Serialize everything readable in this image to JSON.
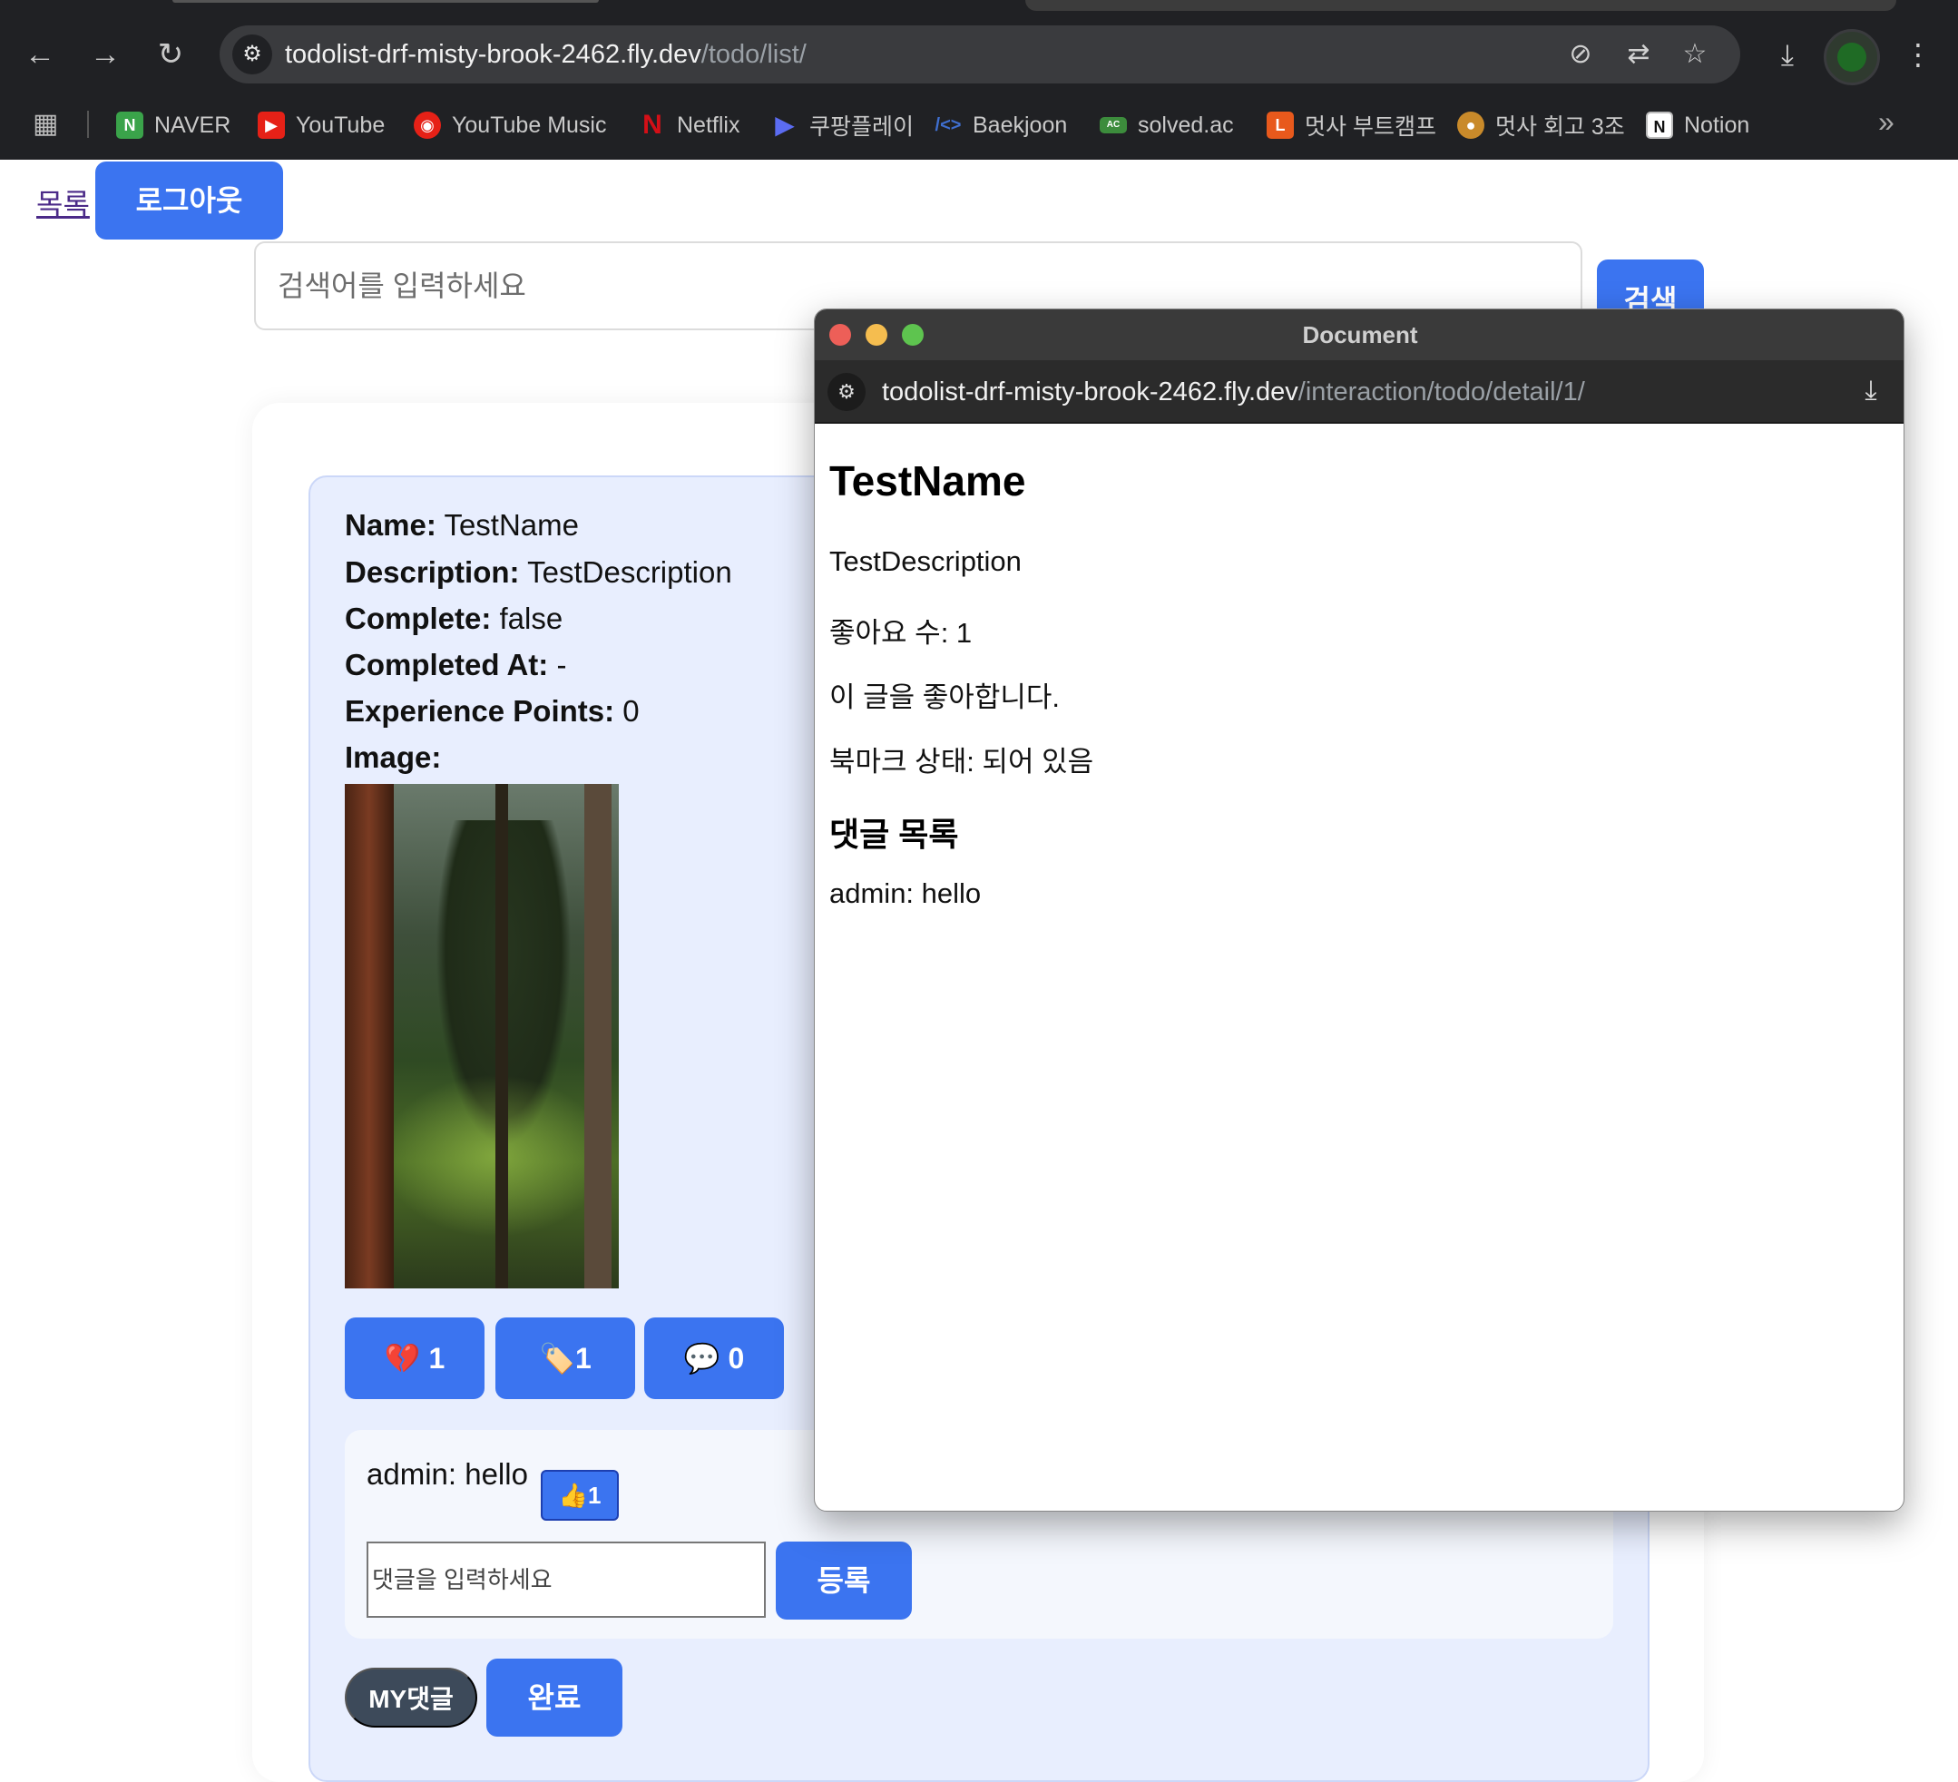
{
  "browser": {
    "url_host": "todolist-drf-misty-brook-2462.fly.dev",
    "url_path": "/todo/list/",
    "bookmarks": [
      {
        "label": "NAVER",
        "icon": "naver-icon",
        "color": "#3aa34a"
      },
      {
        "label": "YouTube",
        "icon": "youtube-icon",
        "color": "#e62117"
      },
      {
        "label": "YouTube Music",
        "icon": "youtube-music-icon",
        "color": "#e62117"
      },
      {
        "label": "Netflix",
        "icon": "netflix-icon",
        "color": "#d40f17"
      },
      {
        "label": "쿠팡플레이",
        "icon": "coupang-play-icon",
        "color": "#5b6cf2"
      },
      {
        "label": "Baekjoon",
        "icon": "baekjoon-icon",
        "color": "#3f6fd0"
      },
      {
        "label": "solved.ac",
        "icon": "solved-ac-icon",
        "color": "#3c8c3c"
      },
      {
        "label": "멋사 부트캠프",
        "icon": "likelion-bootcamp-icon",
        "color": "#e8591c"
      },
      {
        "label": "멋사 회고 3조",
        "icon": "likelion-retro-icon",
        "color": "#c98a2a"
      },
      {
        "label": "Notion",
        "icon": "notion-icon",
        "color": "#ffffff"
      }
    ]
  },
  "page": {
    "list_link": "목록",
    "logout_label": "로그아웃",
    "search_placeholder": "검색어를 입력하세요",
    "search_label": "검색",
    "todo": {
      "name_label": "Name:",
      "name_value": "TestName",
      "description_label": "Description:",
      "description_value": "TestDescription",
      "complete_label": "Complete:",
      "complete_value": "false",
      "completed_at_label": "Completed At:",
      "completed_at_value": "-",
      "xp_label": "Experience Points:",
      "xp_value": "0",
      "image_label": "Image:"
    },
    "actions": {
      "like_icon": "💔",
      "like_count": "1",
      "bookmark_icon": "🏷️",
      "bookmark_count": "1",
      "comment_icon": "💬",
      "comment_count": "0"
    },
    "comment": {
      "text": "admin: hello",
      "like_icon": "👍",
      "like_count": "1",
      "input_placeholder": "댓글을 입력하세요",
      "register_label": "등록"
    },
    "my_comments_label": "MY댓글",
    "complete_label": "완료",
    "accent_color": "#3b74f0"
  },
  "popup": {
    "window_title": "Document",
    "url_host": "todolist-drf-misty-brook-2462.fly.dev",
    "url_path": "/interaction/todo/detail/1/",
    "heading": "TestName",
    "description": "TestDescription",
    "like_count_text": "좋아요 수: 1",
    "like_status_text": "이 글을 좋아합니다.",
    "bookmark_status_text": "북마크 상태: 되어 있음",
    "comments_heading": "댓글 목록",
    "comment_text": "admin: hello"
  }
}
